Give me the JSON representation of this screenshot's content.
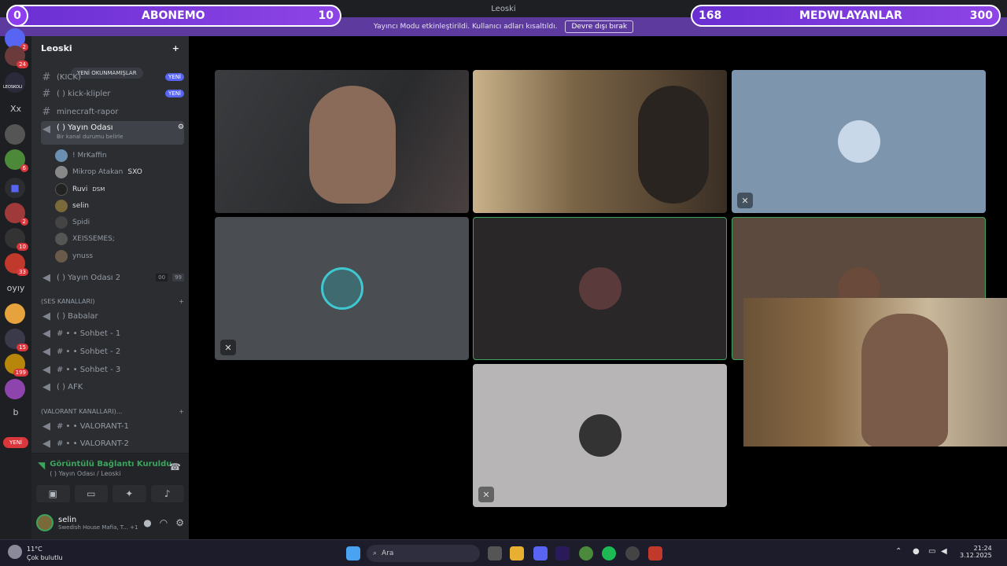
{
  "window": {
    "title": "Leoski"
  },
  "notice": {
    "text": "Yayıncı Modu etkinleştirildi. Kullanıcı adları kısaltıldı.",
    "button": "Devre dışı bırak"
  },
  "overlay": {
    "left": {
      "count": "0",
      "label": "ABONEMO",
      "goal": "10"
    },
    "right": {
      "count": "168",
      "label": "MEDWLAYANLAR",
      "goal": "300"
    }
  },
  "servers": {
    "badges": [
      "2",
      "24",
      "6",
      "2",
      "10",
      "33",
      "15",
      "199"
    ],
    "text_items": [
      "Xx",
      "oyıy",
      "b"
    ],
    "leoskoli_label": "LEOSKOLI",
    "new_badge": "YENİ"
  },
  "guild": {
    "name": "Leoski"
  },
  "channels": {
    "unread_pill": "YENİ OKUNMAMIŞLAR",
    "partial_top": "(KICK)",
    "ch1_new": "YENİ",
    "kick_clips": "(    ) kick-klipler",
    "kick_new": "YENİ",
    "minecraft": "minecraft-rapor",
    "voice_room": "(    ) Yayın Odası",
    "voice_room_status": "Bir kanal durumu belirle",
    "voice_room2": "(    ) Yayın Odası 2",
    "voice_room2_counts": [
      "00",
      "99"
    ],
    "cat_voice": "(SES KANALLARI)",
    "babalar": "(    ) Babalar",
    "sohbet1": "#  •    • Sohbet - 1",
    "sohbet2": "#  •    • Sohbet - 2",
    "sohbet3": "#  •    • Sohbet - 3",
    "afk": "(    ) AFK",
    "cat_valorant": "(VALORANT KANALLARI)...",
    "valo1": "#  •    • VALORANT-1",
    "valo2": "#  •    • VALORANT-2"
  },
  "members": [
    {
      "name": "! MrKaffin",
      "tag": ""
    },
    {
      "name": "Mikrop Atakan",
      "tag": "SXO"
    },
    {
      "name": "Ruvi",
      "tag": "DSM"
    },
    {
      "name": "selin",
      "tag": ""
    },
    {
      "name": "Spidi",
      "tag": ""
    },
    {
      "name": "XEISSEMES;",
      "tag": ""
    },
    {
      "name": "ynuss",
      "tag": ""
    }
  ],
  "voice_panel": {
    "status": "Görüntülü Bağlantı Kuruldu",
    "location": "(    ) Yayın Odası / Leoski"
  },
  "user_panel": {
    "name": "selin",
    "activity": "Swedish House Mafia, T...",
    "extra": "+1"
  },
  "taskbar": {
    "weather_temp": "11°C",
    "weather_desc": "Çok bulutlu",
    "search_placeholder": "Ara",
    "time": "21:24",
    "date": "3.12.2025"
  },
  "colors": {
    "accent": "#5865f2",
    "connected": "#3ba55d",
    "notice": "#5c3a9e",
    "overlay": "#8e44e6"
  },
  "icons": [
    "mute-icon",
    "settings-gear-icon",
    "headphones-icon",
    "microphone-icon",
    "speaker-icon",
    "hash-icon",
    "search-icon",
    "windows-start-icon"
  ]
}
